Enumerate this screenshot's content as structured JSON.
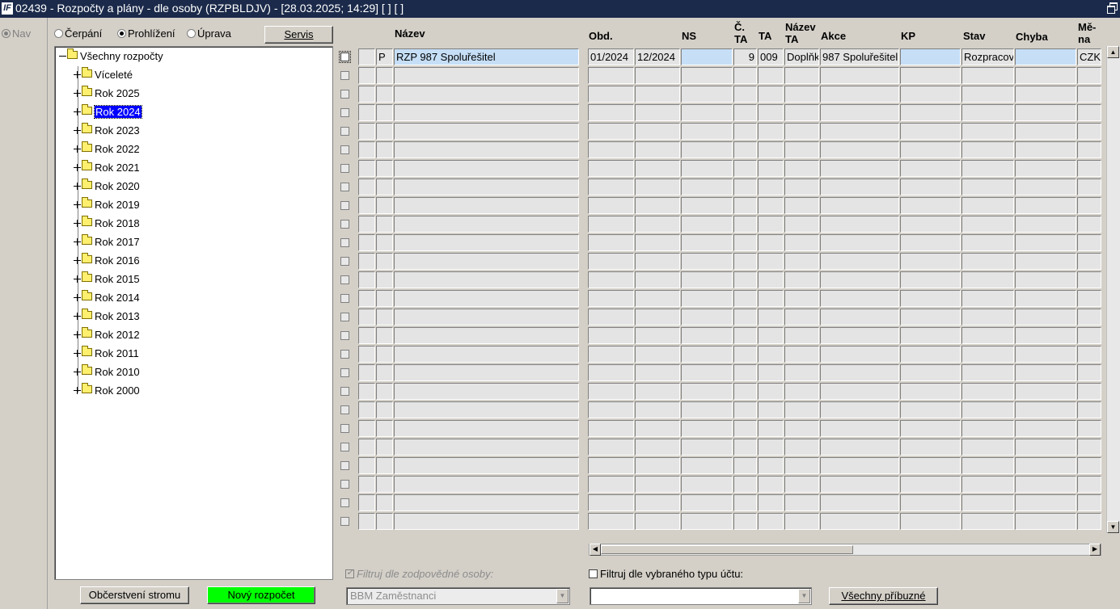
{
  "window": {
    "title": "02439 - Rozpočty a plány - dle osoby (RZPBLDJV) - [28.03.2025; 14:29]  [ ]  [ ]",
    "icon_text": "IF"
  },
  "left_strip": {
    "nav_label": "Nav"
  },
  "mode": {
    "options": [
      "Čerpání",
      "Prohlížení",
      "Úprava"
    ],
    "selected": "Prohlížení"
  },
  "buttons": {
    "servis": "Servis",
    "refresh_tree": "Občerstvení stromu",
    "new_budget": "Nový rozpočet",
    "all_related": "Všechny příbuzné"
  },
  "colors": {
    "new_budget_bg": "#00ff00",
    "selection": "#0000ff",
    "current_row": "#c6dff7"
  },
  "tree": {
    "root": "Všechny rozpočty",
    "selected": "Rok 2024",
    "items": [
      "Víceleté",
      "Rok 2025",
      "Rok 2024",
      "Rok 2023",
      "Rok 2022",
      "Rok 2021",
      "Rok 2020",
      "Rok 2019",
      "Rok 2018",
      "Rok 2017",
      "Rok 2016",
      "Rok 2015",
      "Rok 2014",
      "Rok 2013",
      "Rok 2012",
      "Rok 2011",
      "Rok 2010",
      "Rok 2000"
    ]
  },
  "grid": {
    "headers": {
      "nazev": "Název",
      "obd": "Obd.",
      "ns": "NS",
      "c_ta": "Č. TA",
      "ta": "TA",
      "nazev_ta": "Název TA",
      "akce": "Akce",
      "kp": "KP",
      "stav": "Stav",
      "chyba": "Chyba",
      "mena": "Mě-na"
    },
    "rows": [
      {
        "typ": "P",
        "nazev": "RZP 987 Spoluřešitel",
        "obd_od": "01/2024",
        "obd_do": "12/2024",
        "ns": "",
        "c_ta": "9",
        "ta": "009",
        "nazev_ta": "Doplňk",
        "akce": "987 Spoluřešitel",
        "kp": "",
        "stav": "Rozpracov",
        "chyba": "",
        "mena": "CZK"
      }
    ]
  },
  "filters": {
    "responsible_label": "Filtruj dle zodpovědné osoby:",
    "responsible_checked": true,
    "responsible_value": "BBM Zaměstnanci",
    "account_type_label": "Filtruj dle vybraného typu účtu:",
    "account_type_checked": false,
    "account_type_value": ""
  }
}
